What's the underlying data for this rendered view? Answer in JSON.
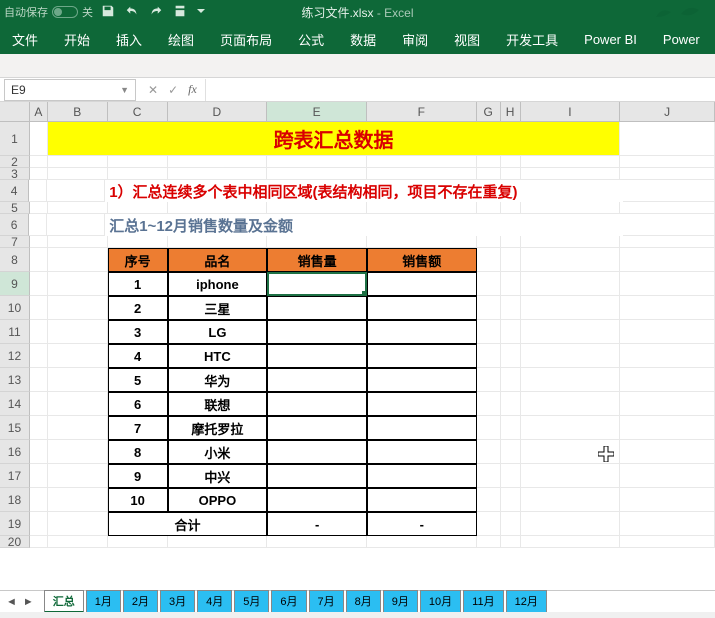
{
  "titlebar": {
    "autosave_label": "自动保存",
    "autosave_state": "关",
    "doc_name": "练习文件.xlsx",
    "app_name": "Excel"
  },
  "ribbon": {
    "tabs": [
      "文件",
      "开始",
      "插入",
      "绘图",
      "页面布局",
      "公式",
      "数据",
      "审阅",
      "视图",
      "开发工具",
      "Power BI",
      "Power"
    ]
  },
  "namebox": {
    "ref": "E9"
  },
  "columns": [
    "A",
    "B",
    "C",
    "D",
    "E",
    "F",
    "G",
    "H",
    "I",
    "J"
  ],
  "row_nums": [
    1,
    2,
    3,
    4,
    5,
    6,
    7,
    8,
    9,
    10,
    11,
    12,
    13,
    14,
    15,
    16,
    17,
    18,
    19,
    20
  ],
  "content": {
    "title": "跨表汇总数据",
    "subtitle1": "1）汇总连续多个表中相同区域(表结构相同，项目不存在重复)",
    "subtitle2": "汇总1~12月销售数量及金额",
    "headers": {
      "c0": "序号",
      "c1": "品名",
      "c2": "销售量",
      "c3": "销售额"
    },
    "rows": [
      {
        "no": "1",
        "name": "iphone",
        "qty": "",
        "amt": ""
      },
      {
        "no": "2",
        "name": "三星",
        "qty": "",
        "amt": ""
      },
      {
        "no": "3",
        "name": "LG",
        "qty": "",
        "amt": ""
      },
      {
        "no": "4",
        "name": "HTC",
        "qty": "",
        "amt": ""
      },
      {
        "no": "5",
        "name": "华为",
        "qty": "",
        "amt": ""
      },
      {
        "no": "6",
        "name": "联想",
        "qty": "",
        "amt": ""
      },
      {
        "no": "7",
        "name": "摩托罗拉",
        "qty": "",
        "amt": ""
      },
      {
        "no": "8",
        "name": "小米",
        "qty": "",
        "amt": ""
      },
      {
        "no": "9",
        "name": "中兴",
        "qty": "",
        "amt": ""
      },
      {
        "no": "10",
        "name": "OPPO",
        "qty": "",
        "amt": ""
      }
    ],
    "total": {
      "label": "合计",
      "qty": "-",
      "amt": "-"
    }
  },
  "sheets": [
    "汇总",
    "1月",
    "2月",
    "3月",
    "4月",
    "5月",
    "6月",
    "7月",
    "8月",
    "9月",
    "10月",
    "11月",
    "12月"
  ],
  "active_sheet": 0,
  "active_cell_col": "E",
  "active_row": 9
}
